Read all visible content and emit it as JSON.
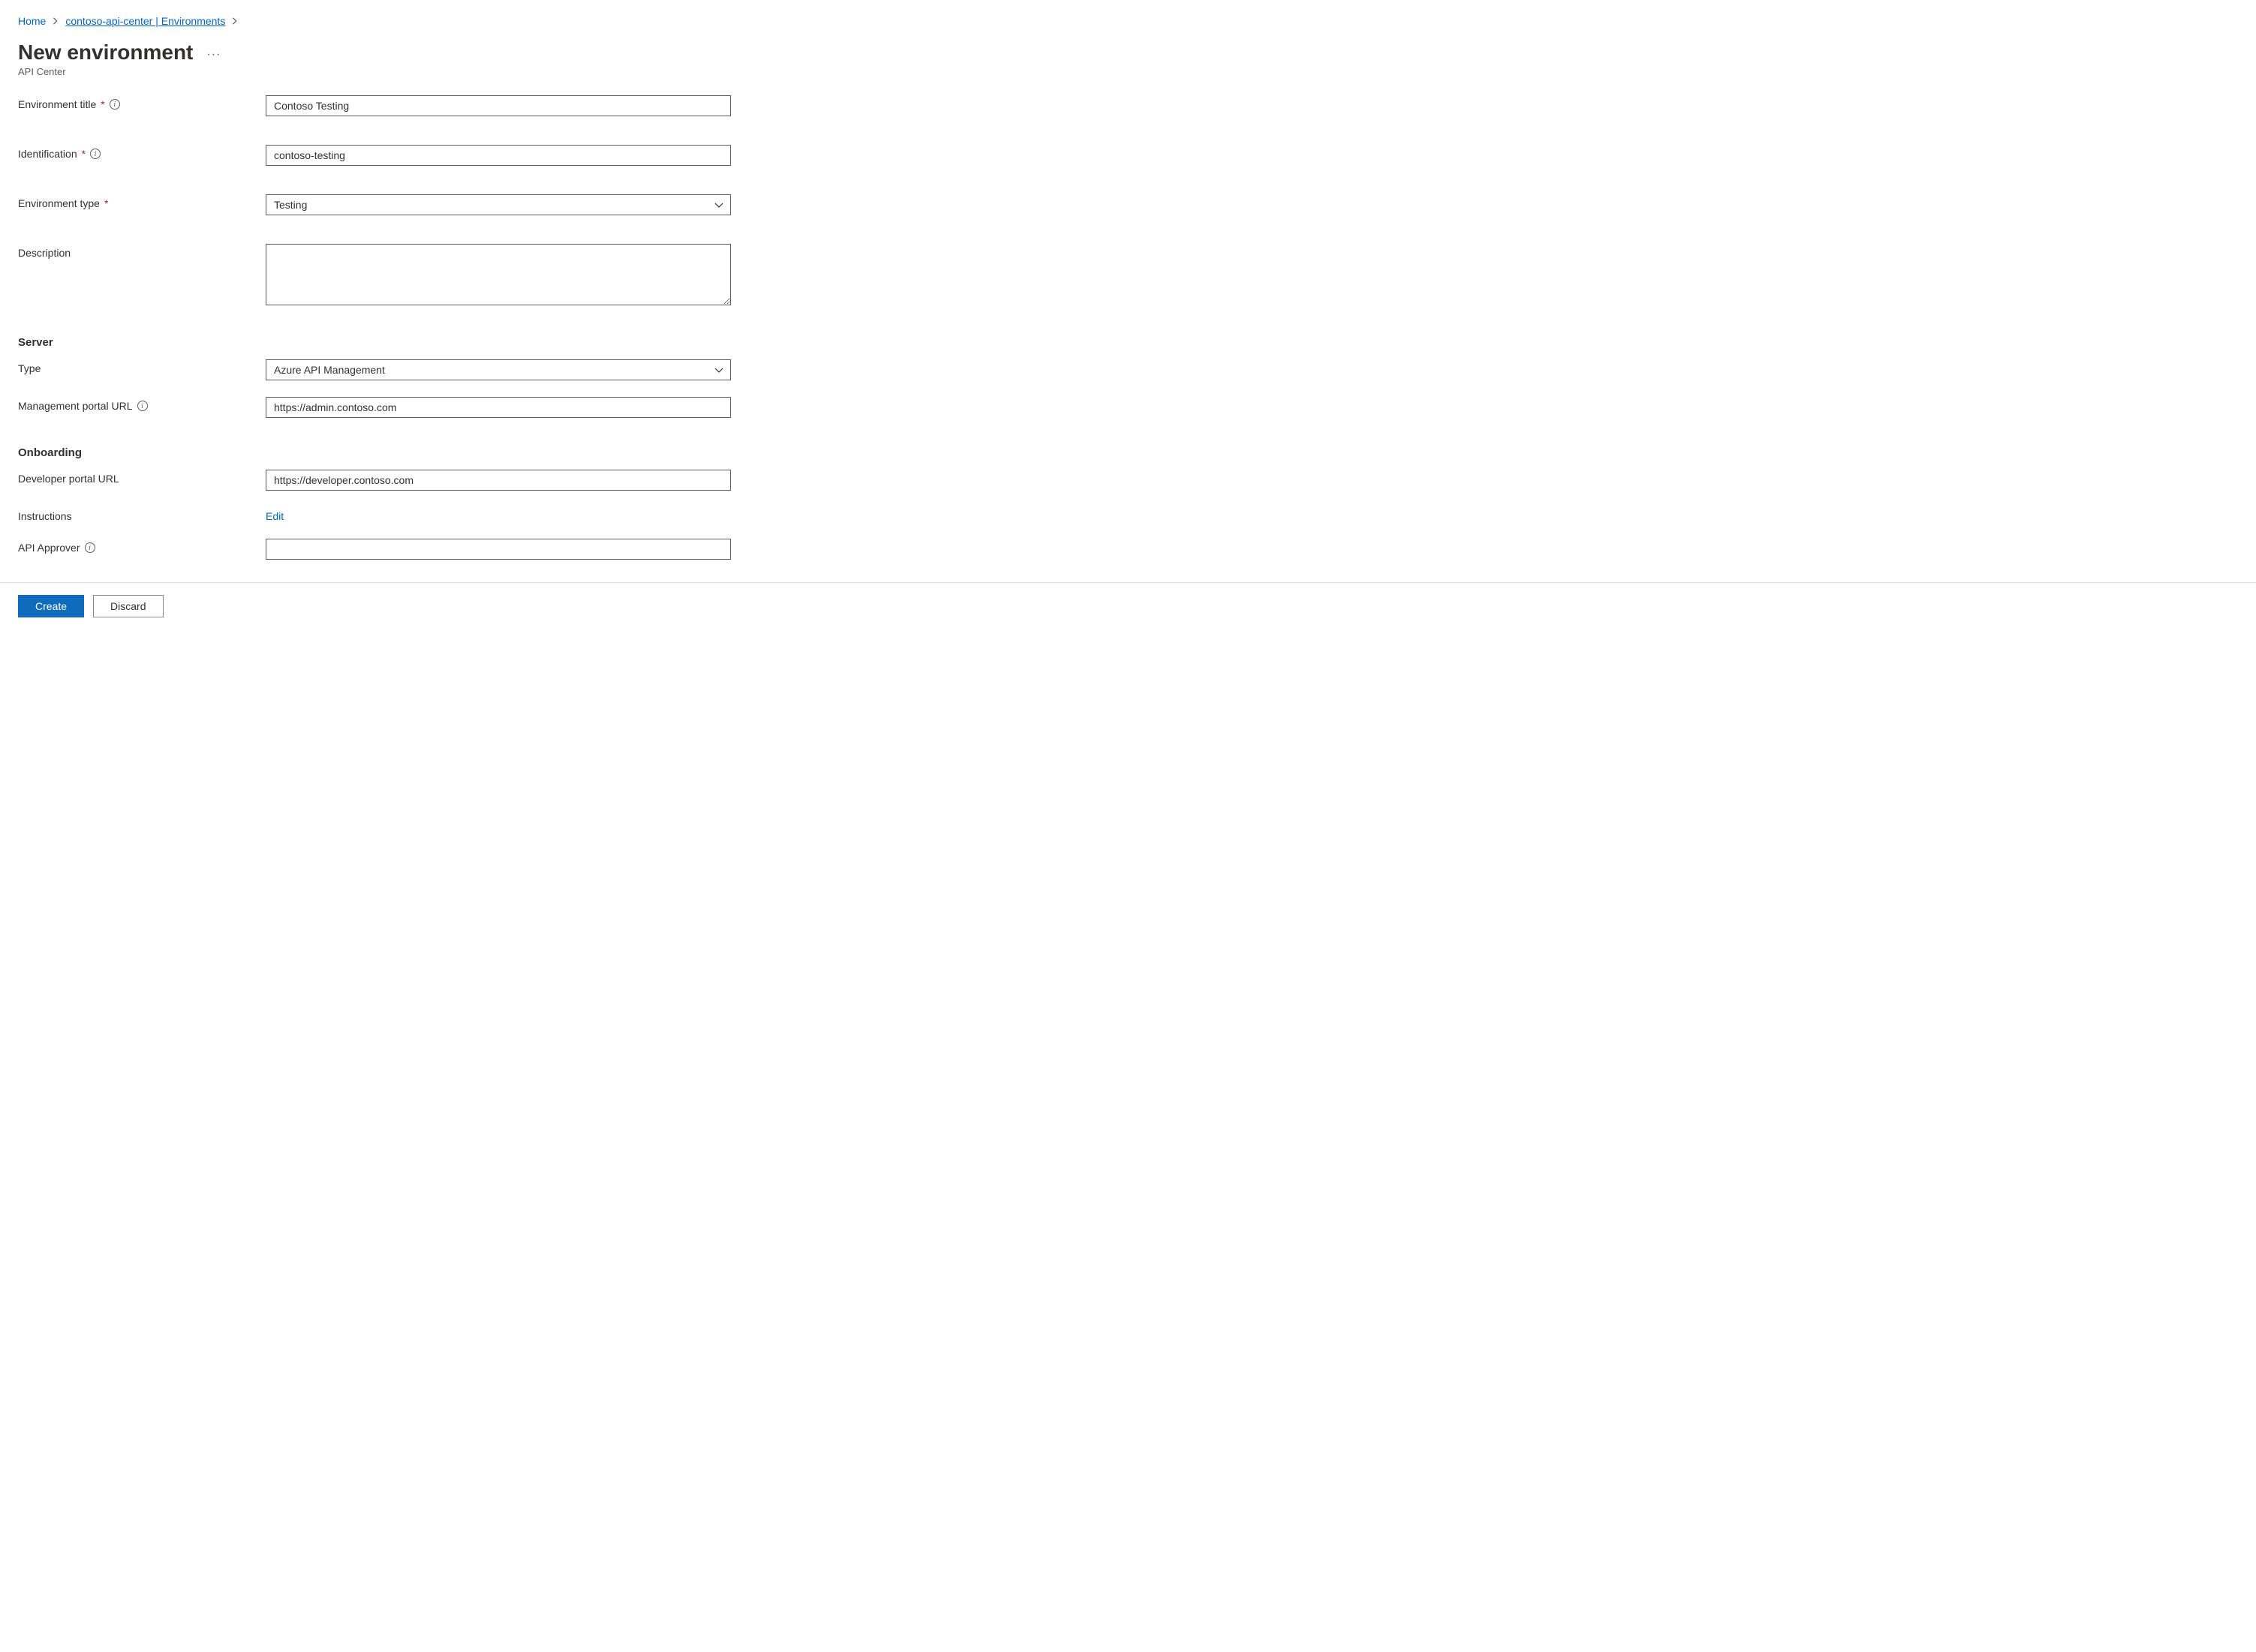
{
  "breadcrumb": {
    "home": "Home",
    "parent": "contoso-api-center | Environments"
  },
  "header": {
    "title": "New environment",
    "subtitle": "API Center",
    "more_actions": "···"
  },
  "form": {
    "env_title": {
      "label": "Environment title",
      "value": "Contoso Testing"
    },
    "identification": {
      "label": "Identification",
      "value": "contoso-testing"
    },
    "env_type": {
      "label": "Environment type",
      "value": "Testing"
    },
    "description": {
      "label": "Description",
      "value": ""
    }
  },
  "server": {
    "heading": "Server",
    "type": {
      "label": "Type",
      "value": "Azure API Management"
    },
    "mgmt_url": {
      "label": "Management portal URL",
      "value": "https://admin.contoso.com"
    }
  },
  "onboarding": {
    "heading": "Onboarding",
    "dev_url": {
      "label": "Developer portal URL",
      "value": "https://developer.contoso.com"
    },
    "instructions": {
      "label": "Instructions",
      "edit_link": "Edit"
    },
    "approver": {
      "label": "API Approver",
      "value": ""
    }
  },
  "footer": {
    "create": "Create",
    "discard": "Discard"
  }
}
